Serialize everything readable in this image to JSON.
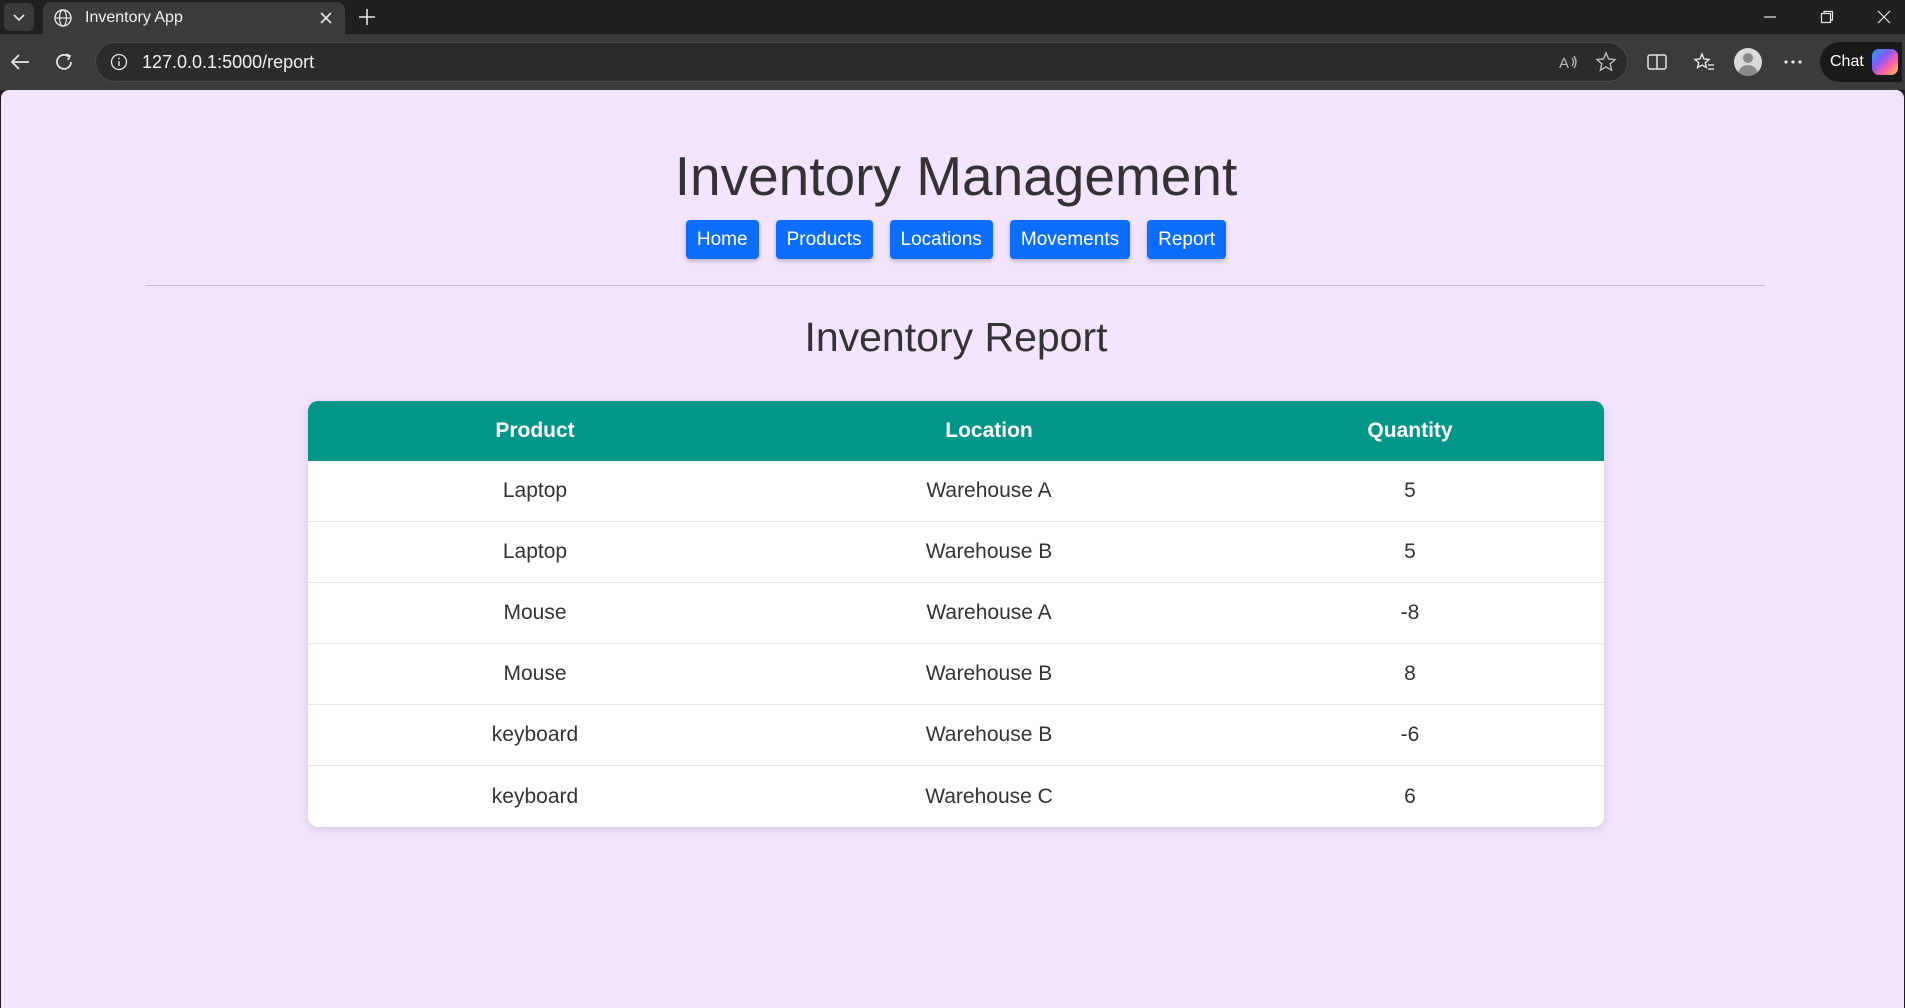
{
  "browser": {
    "tab_title": "Inventory App",
    "url": "127.0.0.1:5000/report",
    "chat_label": "Chat"
  },
  "header": {
    "title": "Inventory Management",
    "nav": [
      "Home",
      "Products",
      "Locations",
      "Movements",
      "Report"
    ]
  },
  "report": {
    "title": "Inventory Report",
    "columns": [
      "Product",
      "Location",
      "Quantity"
    ],
    "rows": [
      [
        "Laptop",
        "Warehouse A",
        "5"
      ],
      [
        "Laptop",
        "Warehouse B",
        "5"
      ],
      [
        "Mouse",
        "Warehouse A",
        "-8"
      ],
      [
        "Mouse",
        "Warehouse B",
        "8"
      ],
      [
        "keyboard",
        "Warehouse B",
        "-6"
      ],
      [
        "keyboard",
        "Warehouse C",
        "6"
      ]
    ]
  },
  "colors": {
    "page_background": "#f3e5ff",
    "nav_button": "#0d6efd",
    "table_header": "#009688"
  }
}
